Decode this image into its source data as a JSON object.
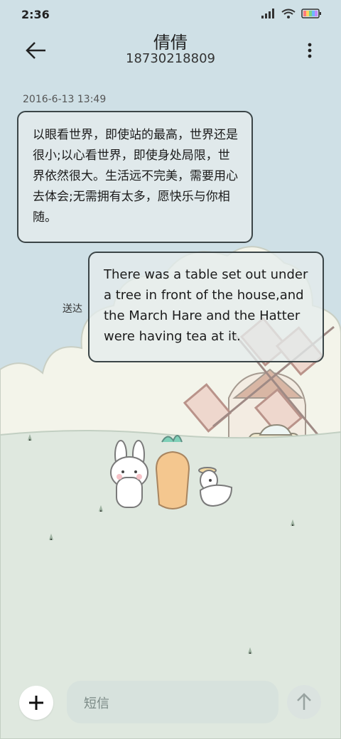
{
  "status_bar": {
    "time": "2:36"
  },
  "header": {
    "contact_name": "倩倩",
    "phone_number": "18730218809"
  },
  "conversation": {
    "timestamp": "2016-6-13 13:49",
    "incoming_message": "以眼看世界，即使站的最高，世界还是很小;以心看世界，即使身处局限，世界依然很大。生活远不完美，需要用心去体会;无需拥有太多，愿快乐与你相随。",
    "outgoing_message": "There was a table set out under a tree in front of the house,and the March Hare and the Hatter were having tea at it.",
    "delivery_status": "送达"
  },
  "composer": {
    "placeholder": "短信"
  },
  "icons": {
    "back": "arrow-left-icon",
    "more": "more-vertical-icon",
    "attach": "plus-icon",
    "send": "arrow-up-icon"
  },
  "colors": {
    "bubble_border": "#3b4547",
    "ground": "#dfe8df",
    "sky": "#cfe0e6"
  }
}
